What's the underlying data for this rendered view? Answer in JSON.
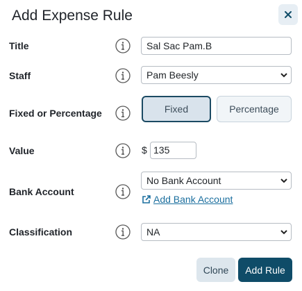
{
  "dialog": {
    "title": "Add Expense Rule"
  },
  "fields": {
    "title": {
      "label": "Title",
      "value": "Sal Sac Pam.B"
    },
    "staff": {
      "label": "Staff",
      "selected": "Pam Beesly"
    },
    "fixed_or_percentage": {
      "label": "Fixed or Percentage",
      "options": [
        "Fixed",
        "Percentage"
      ],
      "selected": "Fixed"
    },
    "value": {
      "label": "Value",
      "currency": "$",
      "value": "135"
    },
    "bank_account": {
      "label": "Bank Account",
      "selected": "No Bank Account",
      "link": "Add Bank Account"
    },
    "classification": {
      "label": "Classification",
      "selected": "NA"
    }
  },
  "actions": {
    "clone_label": "Clone",
    "add_label": "Add Rule"
  },
  "colors": {
    "primary": "#0f4c68",
    "link": "#1a6e9e",
    "secondary_button": "#dde6ed",
    "close_button_bg": "#e7eef4"
  },
  "icons": {
    "close": "close-icon",
    "info": "info-icon",
    "external_link": "external-link-icon",
    "chevron": "chevron-down-icon"
  }
}
